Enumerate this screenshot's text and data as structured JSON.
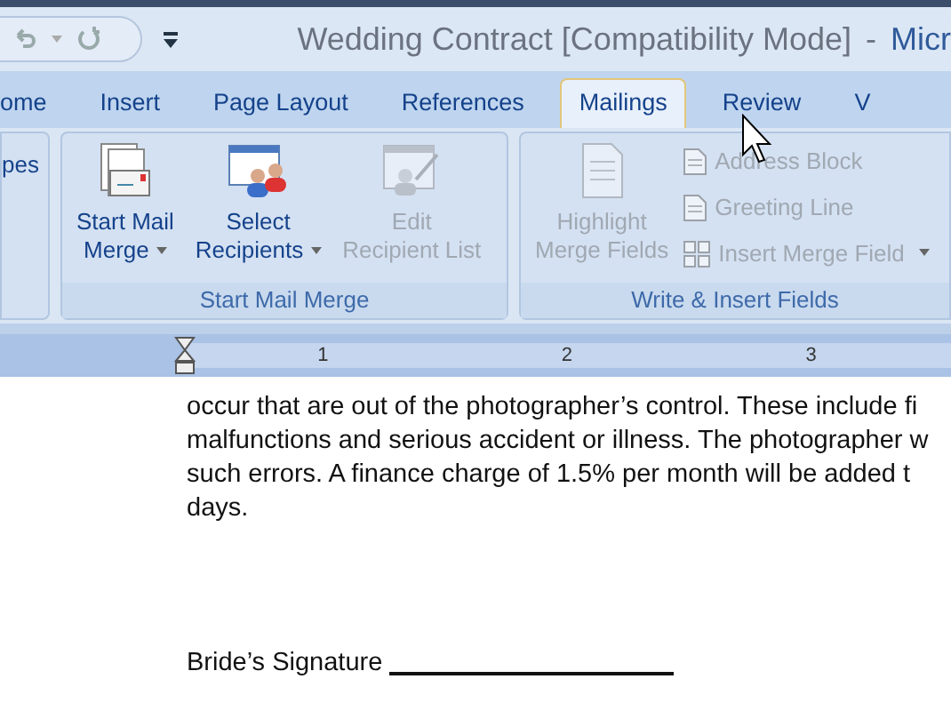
{
  "window": {
    "title": "Wedding Contract [Compatibility Mode]",
    "separator": "-",
    "app_name": "Micr"
  },
  "tabs": [
    {
      "label": "ome",
      "selected": false
    },
    {
      "label": "Insert",
      "selected": false
    },
    {
      "label": "Page Layout",
      "selected": false
    },
    {
      "label": "References",
      "selected": false
    },
    {
      "label": "Mailings",
      "selected": true
    },
    {
      "label": "Review",
      "selected": false
    },
    {
      "label": "V",
      "selected": false
    }
  ],
  "ribbon": {
    "partial_group": {
      "label": "pes"
    },
    "groups": [
      {
        "label": "Start Mail Merge",
        "buttons": [
          {
            "kind": "large",
            "lines": [
              "Start Mail",
              "Merge"
            ],
            "dropdown": true,
            "disabled": false
          },
          {
            "kind": "large",
            "lines": [
              "Select",
              "Recipients"
            ],
            "dropdown": true,
            "disabled": false
          },
          {
            "kind": "large",
            "lines": [
              "Edit",
              "Recipient List"
            ],
            "dropdown": false,
            "disabled": true
          }
        ]
      },
      {
        "label": "Write & Insert Fields",
        "buttons": [
          {
            "kind": "large",
            "lines": [
              "Highlight",
              "Merge Fields"
            ],
            "dropdown": false,
            "disabled": true
          },
          {
            "kind": "small",
            "lines": [
              "Address Block"
            ],
            "dropdown": false,
            "disabled": true
          },
          {
            "kind": "small",
            "lines": [
              "Greeting Line"
            ],
            "dropdown": false,
            "disabled": true
          },
          {
            "kind": "small",
            "lines": [
              "Insert Merge Field"
            ],
            "dropdown": true,
            "disabled": true
          }
        ]
      }
    ]
  },
  "ruler": {
    "numbers": [
      "1",
      "2",
      "3"
    ]
  },
  "document": {
    "lines": [
      "occur that are out of the photographer’s control. These include fi",
      "malfunctions and serious accident or illness. The photographer w",
      "such errors. A finance charge of 1.5% per month will be added t",
      "days."
    ],
    "signature_label": "Bride’s Signature"
  }
}
